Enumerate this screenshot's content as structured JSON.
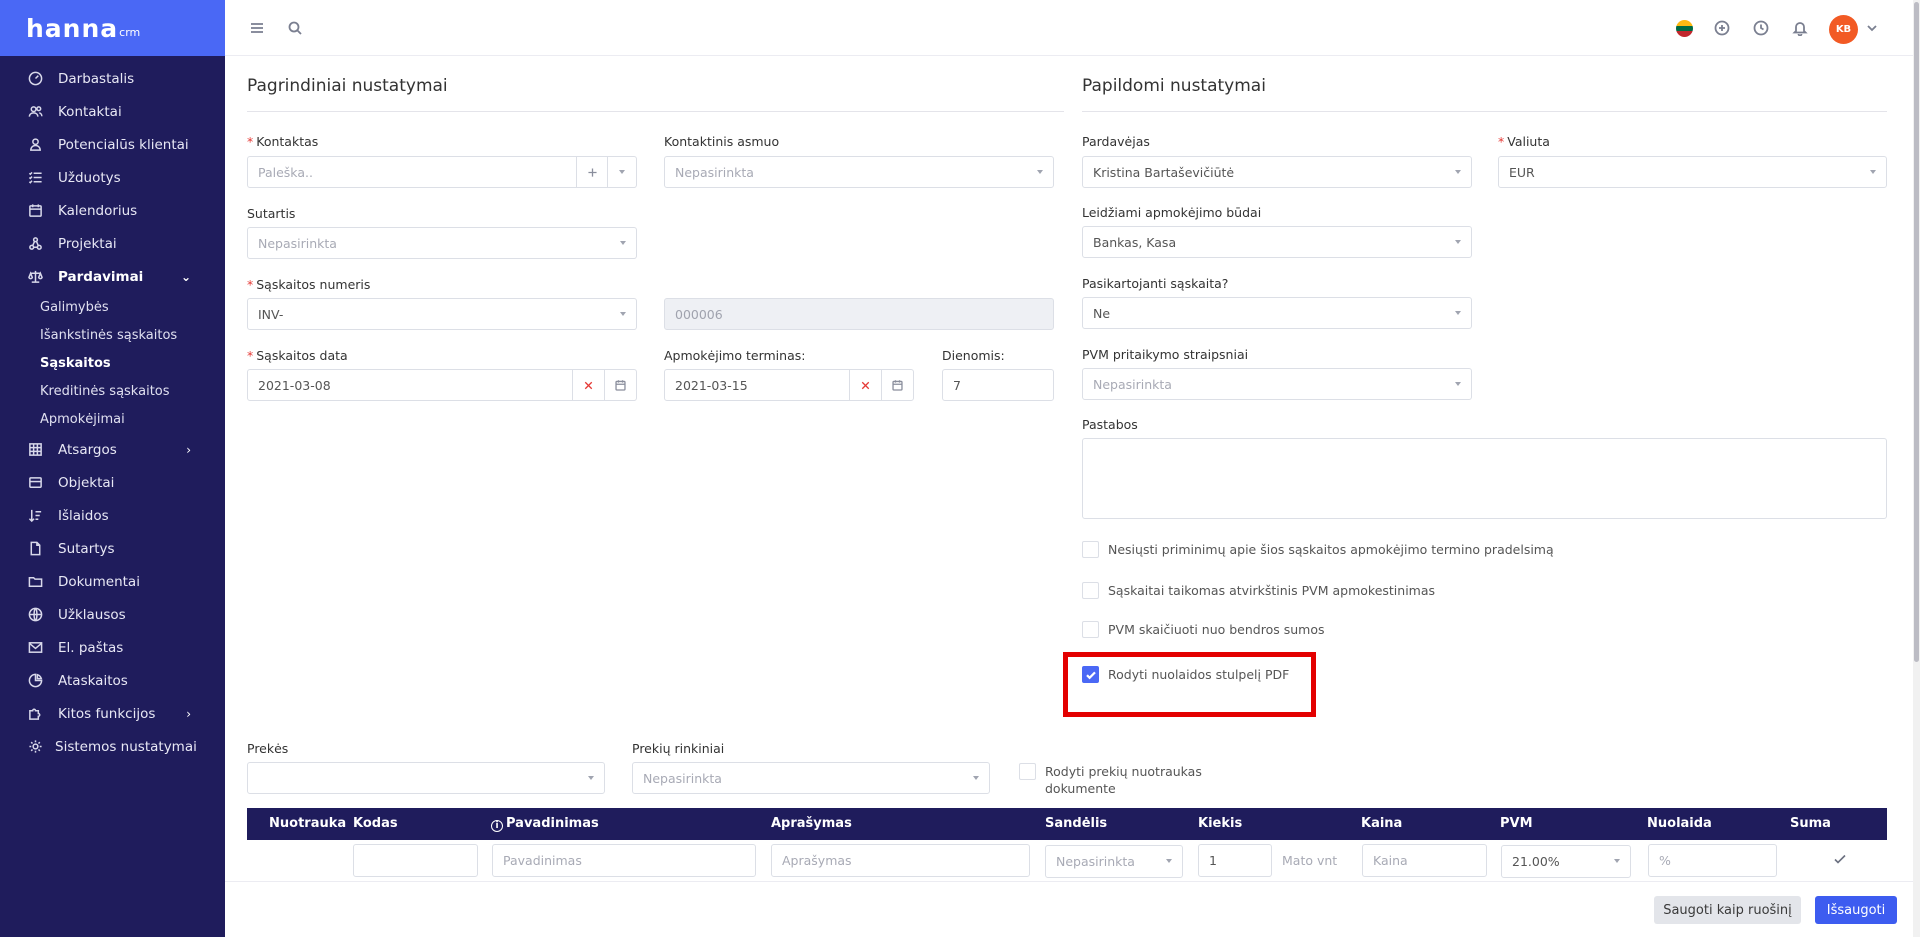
{
  "brand": {
    "name": "hanna",
    "sub": "crm"
  },
  "sidebar": {
    "items": [
      {
        "label": "Darbastalis"
      },
      {
        "label": "Kontaktai"
      },
      {
        "label": "Potencialūs klientai"
      },
      {
        "label": "Užduotys"
      },
      {
        "label": "Kalendorius"
      },
      {
        "label": "Projektai"
      },
      {
        "label": "Pardavimai"
      },
      {
        "label": "Atsargos"
      },
      {
        "label": "Objektai"
      },
      {
        "label": "Išlaidos"
      },
      {
        "label": "Sutartys"
      },
      {
        "label": "Dokumentai"
      },
      {
        "label": "Užklausos"
      },
      {
        "label": "El. paštas"
      },
      {
        "label": "Ataskaitos"
      },
      {
        "label": "Kitos funkcijos"
      },
      {
        "label": "Sistemos nustatymai"
      }
    ],
    "sales_sub": [
      {
        "label": "Galimybės"
      },
      {
        "label": "Išankstinės sąskaitos"
      },
      {
        "label": "Sąskaitos"
      },
      {
        "label": "Kreditinės sąskaitos"
      },
      {
        "label": "Apmokėjimai"
      }
    ]
  },
  "topbar": {
    "avatar_initials": "KB"
  },
  "basic": {
    "title": "Pagrindiniai nustatymai",
    "contact_label": "Kontaktas",
    "contact_value": "Paleška..",
    "contact_person_label": "Kontaktinis asmuo",
    "contact_person_value": "Nepasirinkta",
    "contract_label": "Sutartis",
    "contract_value": "Nepasirinkta",
    "invoice_number_label": "Sąskaitos numeris",
    "invoice_prefix": "INV-",
    "invoice_number": "000006",
    "invoice_date_label": "Sąskaitos data",
    "invoice_date": "2021-03-08",
    "due_label": "Apmokėjimo terminas:",
    "due_date": "2021-03-15",
    "days_label": "Dienomis:",
    "days_value": "7"
  },
  "additional": {
    "title": "Papildomi nustatymai",
    "seller_label": "Pardavėjas",
    "seller_value": "Kristina Bartaševičiūtė",
    "currency_label": "Valiuta",
    "currency_value": "EUR",
    "payment_methods_label": "Leidžiami apmokėjimo būdai",
    "payment_methods_value": "Bankas, Kasa",
    "recurring_label": "Pasikartojanti sąskaita?",
    "recurring_value": "Ne",
    "vat_label": "PVM pritaikymo straipsniai",
    "vat_value": "Nepasirinkta",
    "notes_label": "Pastabos",
    "cb1": "Nesiųsti priminimų apie šios sąskaitos apmokėjimo termino pradelsimą",
    "cb2": "Sąskaitai taikomas atvirkštinis PVM apmokestinimas",
    "cb3": "PVM skaičiuoti nuo bendros sumos",
    "cb4": "Rodyti nuolaidos stulpelį PDF"
  },
  "products": {
    "products_label": "Prekės",
    "sets_label": "Prekių rinkiniai",
    "sets_value": "Nepasirinkta",
    "photos_cb_line1": "Rodyti prekių nuotraukas",
    "photos_cb_line2": "dokumente"
  },
  "table": {
    "headers": {
      "photo": "Nuotrauka",
      "code": "Kodas",
      "name": "Pavadinimas",
      "description": "Aprašymas",
      "warehouse": "Sandėlis",
      "qty": "Kiekis",
      "price": "Kaina",
      "vat": "PVM",
      "discount": "Nuolaida",
      "sum": "Suma"
    },
    "row": {
      "name_placeholder": "Pavadinimas",
      "description_placeholder": "Aprašymas",
      "warehouse_value": "Nepasirinkta",
      "qty_value": "1",
      "unit_placeholder": "Mato vnt",
      "price_placeholder": "Kaina",
      "vat_value": "21.00%",
      "discount_placeholder": "%"
    }
  },
  "footer": {
    "save_draft": "Saugoti kaip ruošinį",
    "save": "Išsaugoti"
  },
  "colors": {
    "sidebar_bg": "#1f1c5c",
    "brand_blue": "#4a68f5",
    "primary_button": "#3d5cf0",
    "highlight": "#e30000",
    "avatar": "#f25a24"
  }
}
